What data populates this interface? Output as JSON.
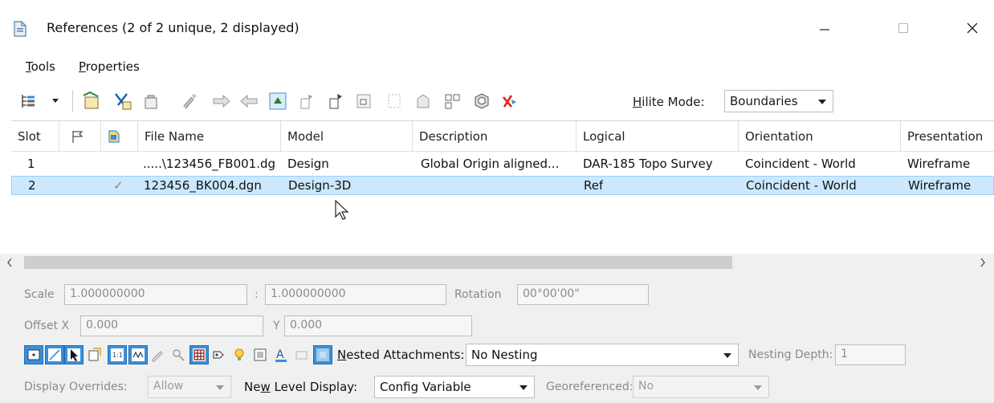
{
  "window": {
    "title": "References (2 of 2 unique, 2 displayed)",
    "icon": "document-icon"
  },
  "menu": {
    "tools": "Tools",
    "tools_mnemonic": "T",
    "tools_rest": "ools",
    "properties": "Properties",
    "properties_mnemonic": "P",
    "properties_rest": "roperties"
  },
  "toolbar": {
    "hilite_mnemonic": "H",
    "hilite_rest": "ilite Mode:",
    "hilite_value": "Boundaries"
  },
  "table": {
    "columns": [
      "Slot",
      "",
      "",
      "File Name",
      "Model",
      "Description",
      "Logical",
      "Orientation",
      "Presentation"
    ],
    "rows": [
      {
        "slot": "1",
        "display": "",
        "file_name": ".....\\123456_FB001.dg",
        "model": "Design",
        "description": "Global Origin aligned...",
        "logical": "DAR-185 Topo Survey",
        "orientation": "Coincident - World",
        "presentation": "Wireframe",
        "selected": false
      },
      {
        "slot": "2",
        "display": "✓",
        "file_name": "123456_BK004.dgn",
        "model": "Design-3D",
        "description": "",
        "logical": "Ref",
        "orientation": "Coincident - World",
        "presentation": "Wireframe",
        "selected": true
      }
    ]
  },
  "properties": {
    "scale_label": "Scale",
    "scale_master": "1.000000000",
    "scale_colon": ":",
    "scale_ref": "1.000000000",
    "rotation_label": "Rotation",
    "rotation_value": "00°00'00\"",
    "offset_x_label": "Offset X",
    "offset_x_value": "0.000",
    "y_label": "Y",
    "offset_y_value": "0.000",
    "nested_mnemonic": "N",
    "nested_rest": "ested Attachments:",
    "nested_value": "No Nesting",
    "nesting_depth_label": "Nesting Depth:",
    "nesting_depth_value": "1",
    "display_overrides_label": "Display Overrides:",
    "display_overrides_value": "Allow",
    "new_level_pre": "Ne",
    "new_level_mnemonic": "w",
    "new_level_rest": " Level Display:",
    "new_level_value": "Config Variable",
    "georeferenced_label": "Georeferenced:",
    "georeferenced_value": "No"
  },
  "colors": {
    "selection_fill": "#cce8ff",
    "selection_border": "#99d1ff",
    "panel_bg": "#f0f0f0",
    "active_icon": "#3b8fd9"
  }
}
